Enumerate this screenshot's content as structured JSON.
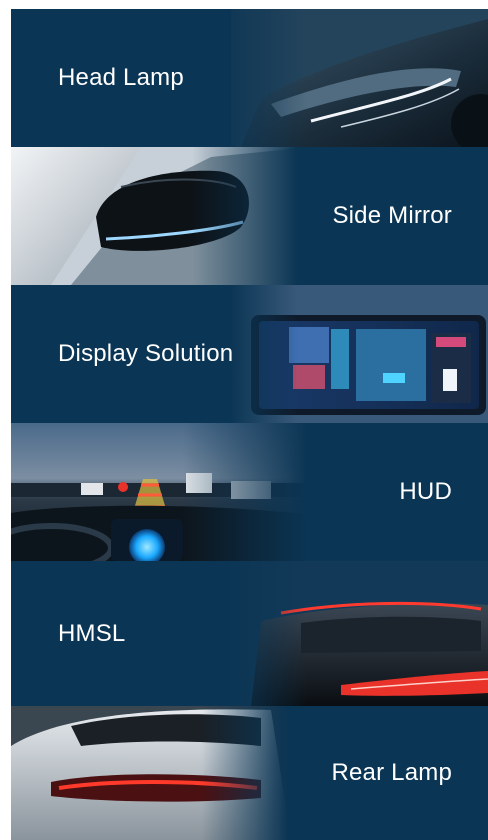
{
  "tiles": [
    {
      "id": "head-lamp",
      "label": "Head Lamp"
    },
    {
      "id": "side-mirror",
      "label": "Side Mirror"
    },
    {
      "id": "display-solution",
      "label": "Display Solution"
    },
    {
      "id": "hud",
      "label": "HUD"
    },
    {
      "id": "hmsl",
      "label": "HMSL"
    },
    {
      "id": "rear-lamp",
      "label": "Rear Lamp"
    }
  ],
  "colors": {
    "tile_background": "#0b3554",
    "text": "#ffffff",
    "lamp_red": "#e8322a"
  }
}
